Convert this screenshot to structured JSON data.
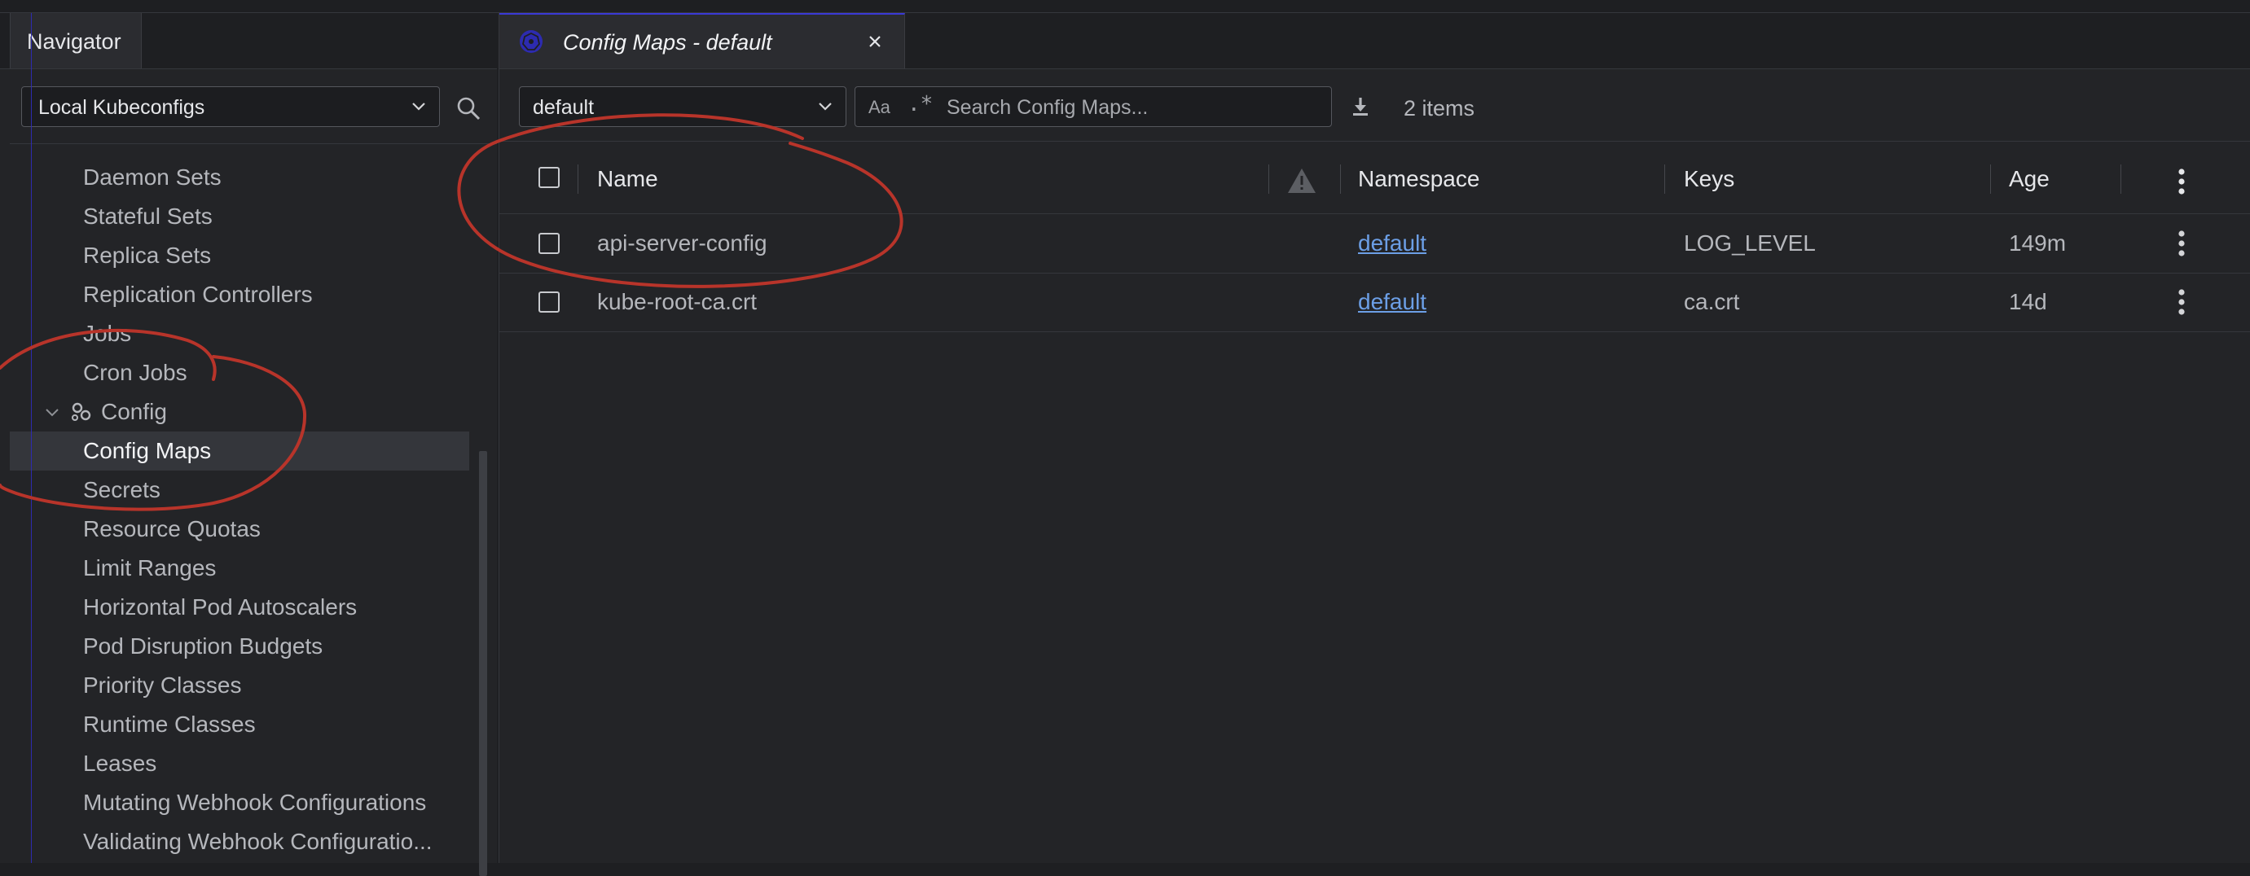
{
  "navigator": {
    "tab_label": "Navigator",
    "context_select": "Local Kubeconfigs",
    "tree": [
      {
        "label": "Daemon Sets",
        "type": "item"
      },
      {
        "label": "Stateful Sets",
        "type": "item"
      },
      {
        "label": "Replica Sets",
        "type": "item"
      },
      {
        "label": "Replication Controllers",
        "type": "item"
      },
      {
        "label": "Jobs",
        "type": "item"
      },
      {
        "label": "Cron Jobs",
        "type": "item"
      },
      {
        "label": "Config",
        "type": "group",
        "icon": "config-icon"
      },
      {
        "label": "Config Maps",
        "type": "item",
        "active": true
      },
      {
        "label": "Secrets",
        "type": "item"
      },
      {
        "label": "Resource Quotas",
        "type": "item"
      },
      {
        "label": "Limit Ranges",
        "type": "item"
      },
      {
        "label": "Horizontal Pod Autoscalers",
        "type": "item"
      },
      {
        "label": "Pod Disruption Budgets",
        "type": "item"
      },
      {
        "label": "Priority Classes",
        "type": "item"
      },
      {
        "label": "Runtime Classes",
        "type": "item"
      },
      {
        "label": "Leases",
        "type": "item"
      },
      {
        "label": "Mutating Webhook Configurations",
        "type": "item"
      },
      {
        "label": "Validating Webhook Configuratio...",
        "type": "item"
      }
    ]
  },
  "main": {
    "tab_title": "Config Maps - default",
    "namespace_select": "default",
    "search": {
      "case_label": "Aa",
      "regex_label": ".*",
      "placeholder": "Search Config Maps..."
    },
    "item_count": "2 items",
    "columns": {
      "name": "Name",
      "namespace": "Namespace",
      "keys": "Keys",
      "age": "Age"
    },
    "rows": [
      {
        "name": "api-server-config",
        "namespace": "default",
        "keys": "LOG_LEVEL",
        "age": "149m"
      },
      {
        "name": "kube-root-ca.crt",
        "namespace": "default",
        "keys": "ca.crt",
        "age": "14d"
      }
    ]
  },
  "colors": {
    "background": "#232427",
    "accent": "#3a39d6",
    "link": "#6c9fe6",
    "annotation": "#b8342a"
  }
}
